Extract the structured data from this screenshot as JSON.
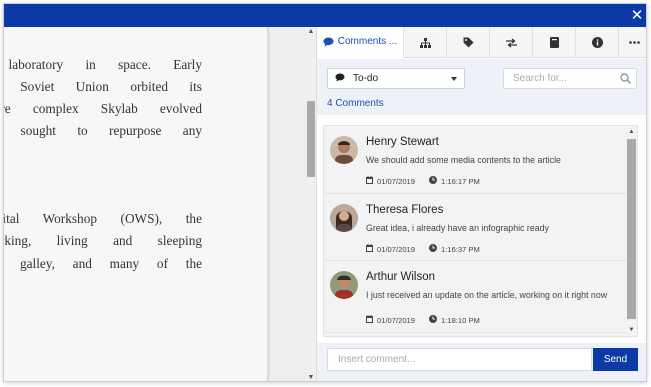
{
  "window": {
    "close_glyph": "✕"
  },
  "document": {
    "paragraph1": [
      "research laboratory in space. Early",
      "and the Soviet Union orbited its",
      "and more complex Skylab evolved",
      ", which sought to repurpose any"
    ],
    "paragraph2": [
      "the Orbital Workshop (OWS), the",
      "ain working, living and sleeping",
      "pment, a galley, and many of the"
    ]
  },
  "panel": {
    "tabs": [
      {
        "icon": "comment-icon",
        "label": "Comments ..."
      },
      {
        "icon": "hierarchy-icon"
      },
      {
        "icon": "tag-icon"
      },
      {
        "icon": "swap-icon"
      },
      {
        "icon": "book-icon"
      },
      {
        "icon": "info-icon"
      },
      {
        "icon": "more-icon"
      }
    ],
    "filter": {
      "value": "To-do"
    },
    "search": {
      "placeholder": "Search for..."
    },
    "count_label": "4 Comments",
    "comments": [
      {
        "name": "Henry Stewart",
        "text": "We should add some media contents to the article",
        "date": "01/07/2019",
        "time": "1:16:17 PM",
        "avatar_color": "#6b4a3a"
      },
      {
        "name": "Theresa Flores",
        "text": "Great idea, i already have an infographic ready",
        "date": "01/07/2019",
        "time": "1:16:37 PM",
        "avatar_color": "#3b2a22"
      },
      {
        "name": "Arthur Wilson",
        "text": "I just received an update on the article, working on it right now",
        "date": "01/07/2019",
        "time": "1:18:10 PM",
        "avatar_color": "#4a5a3a"
      }
    ],
    "composer": {
      "placeholder": "Insert comment...",
      "send_label": "Send"
    }
  },
  "colors": {
    "brand": "#0b3aa6",
    "link": "#1a4fb5",
    "filter_bg": "#eef1f7"
  }
}
